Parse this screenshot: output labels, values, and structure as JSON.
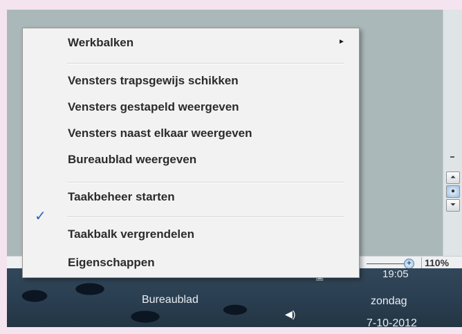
{
  "context_menu": {
    "items": [
      {
        "label": "Werkbalken",
        "submenu": true
      },
      {
        "label": "Vensters trapsgewijs schikken"
      },
      {
        "label": "Vensters gestapeld weergeven"
      },
      {
        "label": "Vensters naast elkaar weergeven"
      },
      {
        "label": "Bureaublad weergeven"
      },
      {
        "label": "Taakbeheer starten"
      },
      {
        "label": "Taakbalk vergrendelen",
        "checked": true
      },
      {
        "label": "Eigenschappen"
      }
    ]
  },
  "statusbar": {
    "zoom_level": "110%"
  },
  "taskbar": {
    "button_label": "Bureaublad",
    "clock": {
      "time": "19:05",
      "day": "zondag",
      "date": "7-10-2012"
    }
  },
  "colors": {
    "menu_background": "#f2f2f2",
    "taskbar_background": "#2a3e51",
    "checkmark": "#2f63b8"
  }
}
